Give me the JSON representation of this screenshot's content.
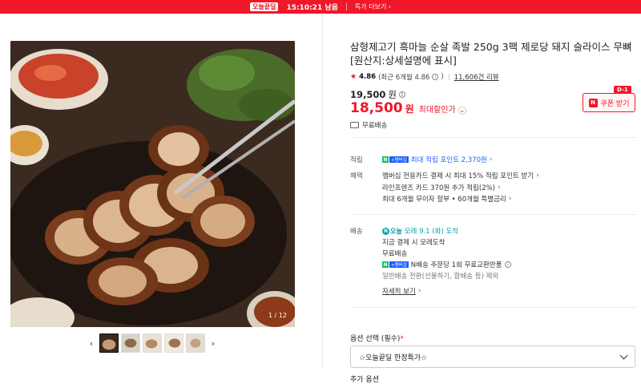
{
  "banner": {
    "title": "오늘끝딜",
    "timer": "15:10:21 남음",
    "link": "특가 더보기 ›"
  },
  "gallery": {
    "counter": "1 / 12",
    "prev": "‹",
    "next": "›",
    "thumb_count": 5
  },
  "product": {
    "title": "삼형제고기 흑마늘 순살 족발 250g 3팩 제로당 돼지 슬라이스 무뼈 [원산지:상세설명에 표시]",
    "rating": {
      "star": "★",
      "score": "4.86",
      "recent": "(최근 6개월 4.86",
      "recent_close": ")",
      "reviews": "11,606건 리뷰"
    },
    "original_price": "19,500",
    "original_won": "원",
    "sale_price": "18,500",
    "sale_won": "원",
    "sale_label": "최대할인가",
    "coupon": {
      "badge": "D-1",
      "icon": "N",
      "label": "쿠폰 받기"
    },
    "shipping_free": "무료배송"
  },
  "benefits": {
    "points_label": "적립",
    "points_text": "최대 적립 포인트 2,370원",
    "discount_label": "혜택",
    "discount_lines": [
      "멤버십 전용카드 결제 시 최대 15% 적립 포인트 받기",
      "라인프렌즈 카드 370원 추가 적립(2%)",
      "최대 6개월 무이자 할부 • 60개월 특별금리"
    ]
  },
  "delivery": {
    "label": "배송",
    "today_badge": "오늘",
    "arrival": "모레 9.1 (화) 도착",
    "line2": "지금 결제 시 모레도착",
    "line3": "무료배송",
    "line4": "N배송 주문당 1회 무료교환반품",
    "line5": "일반배송 전환(선물하기, 합배송 등) 제외",
    "more": "자세히 보기"
  },
  "npay_badge": {
    "n": "N",
    "plus": "+멤버십"
  },
  "options": {
    "label": "옵션 선택",
    "label_suffix": "(필수)",
    "required_mark": "*",
    "selected": "☆오늘끝딜 한정특가☆",
    "add_label": "추가 옵션"
  },
  "colors": {
    "accent_red": "#f0172a",
    "npay_green": "#03c75a",
    "link_blue": "#1f5fff",
    "teal": "#00a2b5"
  }
}
